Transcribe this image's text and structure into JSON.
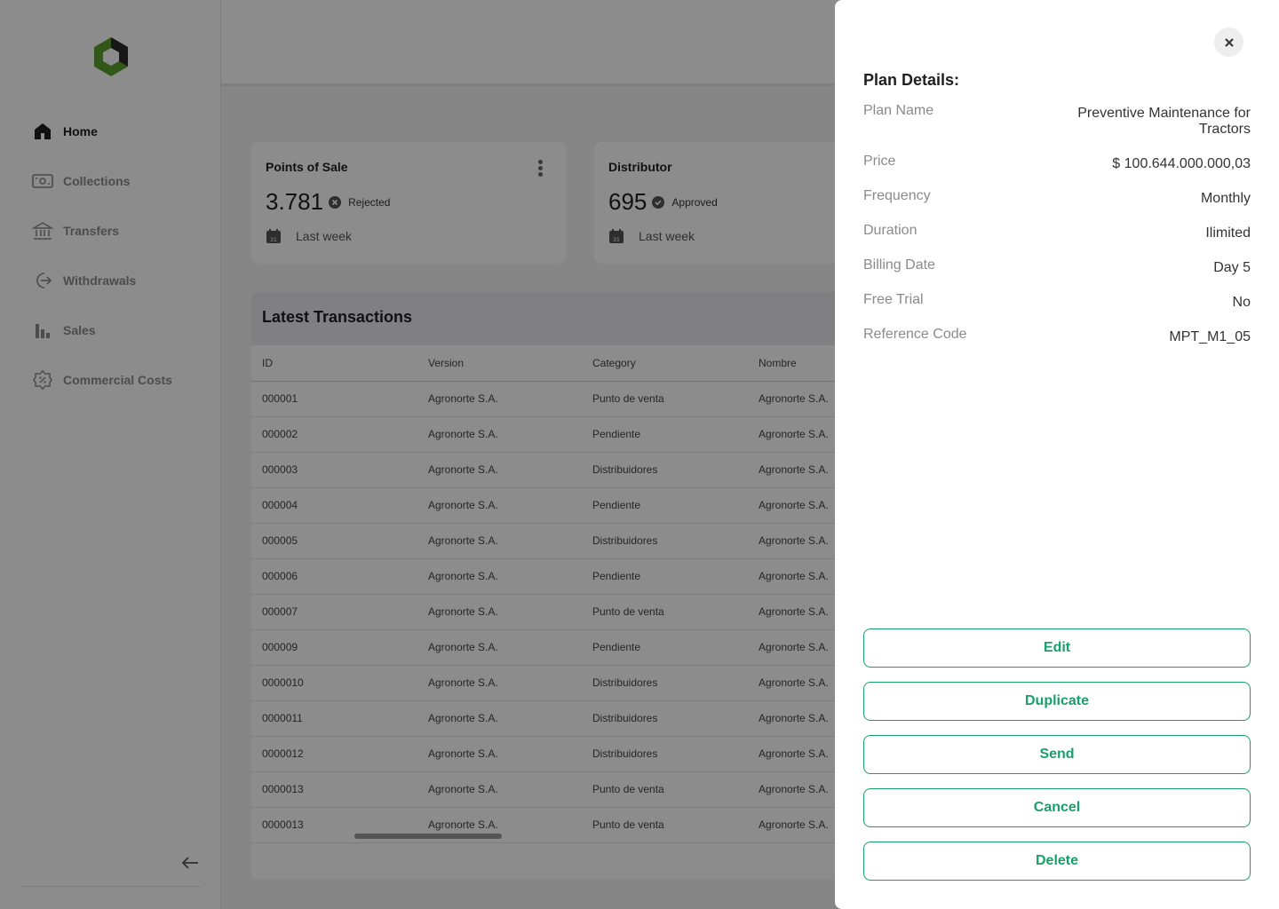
{
  "sidebar": {
    "items": [
      {
        "label": "Home",
        "icon": "home-icon"
      },
      {
        "label": "Collections",
        "icon": "collections-icon"
      },
      {
        "label": "Transfers",
        "icon": "bank-icon"
      },
      {
        "label": "Withdrawals",
        "icon": "withdraw-icon"
      },
      {
        "label": "Sales",
        "icon": "bar-chart-icon"
      },
      {
        "label": "Commercial Costs",
        "icon": "percent-badge-icon"
      }
    ]
  },
  "cards": [
    {
      "title": "Points of Sale",
      "value": "3.781",
      "status": "Rejected",
      "date": "Last week"
    },
    {
      "title": "Distributor",
      "value": "695",
      "status": "Approved",
      "date": "Last week"
    }
  ],
  "table": {
    "title": "Latest Transactions",
    "columns": [
      "ID",
      "Version",
      "Category",
      "Nombre"
    ],
    "rows": [
      [
        "000001",
        "Agronorte S.A.",
        "Punto de  venta",
        "Agronorte S.A."
      ],
      [
        "000002",
        "Agronorte S.A.",
        "Pendiente",
        "Agronorte S.A."
      ],
      [
        "000003",
        "Agronorte S.A.",
        "Distribuidores",
        "Agronorte S.A."
      ],
      [
        "000004",
        "Agronorte S.A.",
        "Pendiente",
        "Agronorte S.A."
      ],
      [
        "000005",
        "Agronorte S.A.",
        "Distribuidores",
        "Agronorte S.A."
      ],
      [
        "000006",
        "Agronorte S.A.",
        "Pendiente",
        "Agronorte S.A."
      ],
      [
        "000007",
        "Agronorte S.A.",
        "Punto de  venta",
        "Agronorte S.A."
      ],
      [
        "000009",
        "Agronorte S.A.",
        "Pendiente",
        "Agronorte S.A."
      ],
      [
        "0000010",
        "Agronorte S.A.",
        "Distribuidores",
        "Agronorte S.A."
      ],
      [
        "0000011",
        "Agronorte S.A.",
        "Distribuidores",
        "Agronorte S.A."
      ],
      [
        "0000012",
        "Agronorte S.A.",
        "Distribuidores",
        "Agronorte S.A."
      ],
      [
        "0000013",
        "Agronorte S.A.",
        "Punto de  venta",
        "Agronorte S.A."
      ],
      [
        "0000013",
        "Agronorte S.A.",
        "Punto de  venta",
        "Agronorte S.A."
      ]
    ]
  },
  "drawer": {
    "title": "Plan Details:",
    "details": [
      {
        "label": "Plan Name",
        "value": "Preventive Maintenance for Tractors"
      },
      {
        "label": "Price",
        "value": "$ 100.644.000.000,03"
      },
      {
        "label": "Frequency",
        "value": "Monthly"
      },
      {
        "label": "Duration",
        "value": "Ilimited"
      },
      {
        "label": "Billing Date",
        "value": "Day 5"
      },
      {
        "label": "Free Trial",
        "value": "No"
      },
      {
        "label": "Reference Code",
        "value": "MPT_M1_05"
      }
    ],
    "buttons": [
      "Edit",
      "Duplicate",
      "Send",
      "Cancel",
      "Delete"
    ]
  },
  "colors": {
    "accent": "#1a9e6a",
    "logo_green": "#5aa02c",
    "overlay": "rgba(0,0,0,0.45)"
  }
}
